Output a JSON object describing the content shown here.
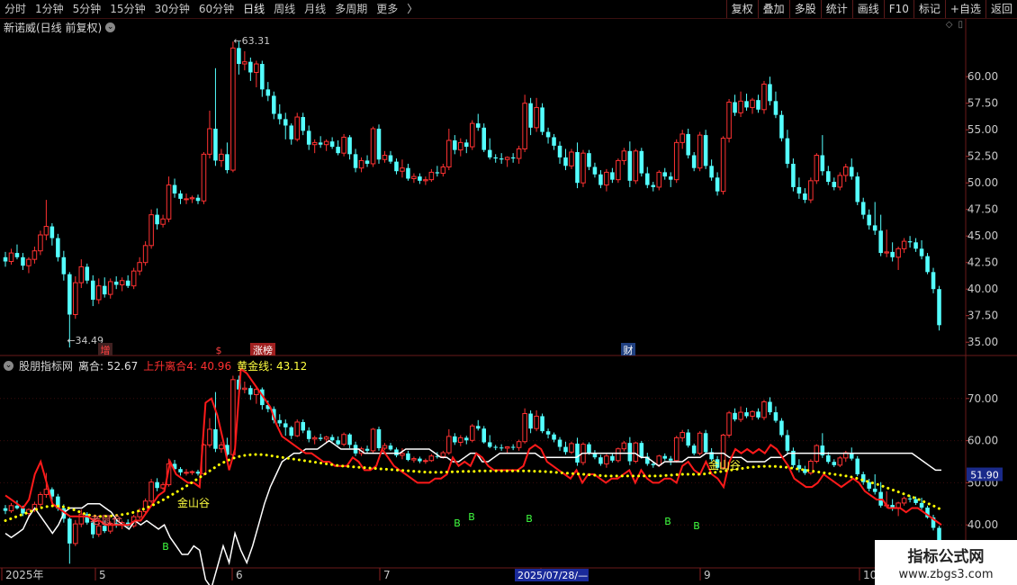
{
  "toolbar": {
    "periods": [
      "分时",
      "1分钟",
      "5分钟",
      "15分钟",
      "30分钟",
      "60分钟",
      "日线",
      "周线",
      "月线",
      "多周期",
      "更多"
    ],
    "active_period": "日线",
    "more_arrow": "〉",
    "right_buttons": [
      "复权",
      "叠加",
      "多股",
      "统计",
      "画线",
      "F10",
      "标记",
      "+自选",
      "返回"
    ]
  },
  "main_chart": {
    "title": "新诺威(日线 前复权)",
    "expand_icon": "chevron-down-icon",
    "high_label": "63.31",
    "low_label": "34.49",
    "y_ticks": [
      "60.00",
      "57.50",
      "55.00",
      "52.50",
      "50.00",
      "47.50",
      "45.00",
      "42.50",
      "40.00",
      "37.50",
      "35.00"
    ],
    "markers": [
      {
        "text": "增",
        "color": "#ff4040",
        "bg": "#402020"
      },
      {
        "text": "$",
        "color": "#ff4040",
        "bg": ""
      },
      {
        "text": "涨榜",
        "color": "#ffffff",
        "bg": "#a02020"
      },
      {
        "text": "财",
        "color": "#ffffff",
        "bg": "#204080"
      }
    ]
  },
  "indicator": {
    "name": "股朋指标网",
    "lihe_label": "离合: 52.67",
    "rise_label": "上升离合4: 40.96",
    "gold_label": "黄金线: 43.12",
    "y_ticks": [
      "70.00",
      "60.00",
      "50.00",
      "40.00"
    ],
    "current_value": "51.90",
    "labels": {
      "rat": "老鼠仓",
      "golden_valley_1": "金山谷",
      "golden_valley_2": "金山谷"
    },
    "buy_signal": "B"
  },
  "x_axis": {
    "labels": [
      "2025年",
      "5",
      "6",
      "7",
      "8",
      "9",
      "10"
    ],
    "cursor_date": "2025/07/28/—"
  },
  "watermark": {
    "line1": "指标公式网",
    "line2": "www.zbgs3.com"
  },
  "colors": {
    "up": "#ff3232",
    "down": "#54ffff",
    "background": "#000000",
    "grid": "#5a1a1a",
    "gold": "#ffff00"
  },
  "chart_data": {
    "type": "candlestick",
    "price_range": [
      34.0,
      64.0
    ],
    "candles": [
      [
        43.0,
        43.5,
        42.1,
        42.6
      ],
      [
        42.6,
        43.8,
        42.3,
        43.4
      ],
      [
        43.4,
        44.2,
        42.8,
        43.0
      ],
      [
        43.0,
        43.4,
        41.8,
        42.2
      ],
      [
        42.2,
        43.0,
        41.5,
        42.8
      ],
      [
        42.8,
        44.0,
        42.4,
        43.6
      ],
      [
        43.6,
        45.5,
        43.2,
        45.1
      ],
      [
        45.1,
        48.4,
        44.6,
        45.9
      ],
      [
        45.9,
        46.2,
        44.1,
        44.8
      ],
      [
        44.8,
        45.2,
        42.6,
        43.0
      ],
      [
        43.0,
        43.6,
        40.8,
        41.4
      ],
      [
        41.4,
        41.6,
        34.5,
        37.6
      ],
      [
        37.6,
        41.2,
        37.2,
        40.6
      ],
      [
        40.6,
        42.8,
        40.1,
        42.1
      ],
      [
        42.1,
        42.4,
        40.5,
        40.8
      ],
      [
        40.8,
        41.3,
        38.4,
        39.0
      ],
      [
        39.0,
        41.0,
        38.6,
        40.3
      ],
      [
        40.3,
        41.1,
        39.2,
        39.5
      ],
      [
        39.5,
        41.0,
        39.1,
        40.7
      ],
      [
        40.7,
        41.2,
        40.0,
        40.4
      ],
      [
        40.4,
        41.1,
        39.8,
        40.8
      ],
      [
        40.8,
        41.3,
        40.1,
        40.3
      ],
      [
        40.3,
        42.0,
        40.0,
        41.7
      ],
      [
        41.7,
        43.0,
        41.3,
        42.5
      ],
      [
        42.5,
        44.5,
        42.2,
        44.1
      ],
      [
        44.1,
        47.5,
        43.8,
        47.0
      ],
      [
        47.0,
        47.6,
        45.6,
        46.1
      ],
      [
        46.1,
        47.0,
        45.8,
        46.6
      ],
      [
        46.6,
        50.6,
        46.3,
        49.8
      ],
      [
        49.8,
        50.4,
        48.6,
        49.0
      ],
      [
        49.0,
        49.3,
        48.0,
        48.5
      ],
      [
        48.5,
        49.0,
        48.0,
        48.5
      ],
      [
        48.5,
        48.8,
        48.1,
        48.6
      ],
      [
        48.6,
        48.9,
        48.0,
        48.3
      ],
      [
        48.3,
        52.9,
        48.0,
        52.7
      ],
      [
        52.7,
        56.8,
        52.3,
        55.1
      ],
      [
        55.1,
        60.8,
        51.6,
        52.1
      ],
      [
        52.1,
        53.2,
        51.5,
        52.7
      ],
      [
        52.7,
        53.8,
        50.9,
        51.2
      ],
      [
        51.2,
        63.3,
        51.0,
        62.7
      ],
      [
        62.7,
        63.31,
        60.2,
        61.2
      ],
      [
        61.2,
        62.4,
        60.6,
        61.4
      ],
      [
        61.4,
        61.8,
        59.6,
        60.4
      ],
      [
        60.4,
        61.5,
        59.0,
        61.2
      ],
      [
        61.2,
        61.5,
        58.1,
        58.8
      ],
      [
        58.8,
        59.5,
        57.7,
        58.2
      ],
      [
        58.2,
        58.6,
        56.0,
        56.5
      ],
      [
        56.5,
        57.4,
        55.5,
        56.0
      ],
      [
        56.0,
        56.6,
        54.1,
        55.4
      ],
      [
        55.4,
        55.6,
        53.6,
        54.1
      ],
      [
        54.1,
        56.6,
        53.9,
        56.2
      ],
      [
        56.2,
        56.6,
        54.5,
        54.9
      ],
      [
        54.9,
        55.4,
        53.1,
        53.6
      ],
      [
        53.6,
        54.1,
        52.8,
        53.8
      ],
      [
        53.8,
        54.4,
        53.3,
        53.6
      ],
      [
        53.6,
        54.1,
        53.0,
        53.9
      ],
      [
        53.9,
        54.3,
        53.2,
        53.4
      ],
      [
        53.4,
        54.0,
        52.6,
        52.8
      ],
      [
        52.8,
        54.6,
        52.5,
        54.3
      ],
      [
        54.3,
        54.5,
        52.2,
        52.7
      ],
      [
        52.7,
        53.2,
        51.0,
        51.4
      ],
      [
        51.4,
        52.4,
        51.0,
        52.1
      ],
      [
        52.1,
        52.6,
        51.5,
        51.8
      ],
      [
        51.8,
        55.3,
        51.5,
        55.1
      ],
      [
        55.1,
        55.5,
        51.8,
        52.2
      ],
      [
        52.2,
        53.0,
        51.9,
        52.6
      ],
      [
        52.6,
        53.0,
        51.8,
        52.0
      ],
      [
        52.0,
        52.3,
        50.8,
        51.1
      ],
      [
        51.1,
        52.2,
        50.5,
        51.4
      ],
      [
        51.4,
        51.8,
        50.2,
        50.4
      ],
      [
        50.4,
        50.9,
        50.0,
        50.6
      ],
      [
        50.6,
        50.9,
        49.9,
        50.2
      ],
      [
        50.2,
        50.6,
        49.8,
        50.3
      ],
      [
        50.3,
        51.3,
        50.1,
        51.0
      ],
      [
        51.0,
        51.6,
        50.6,
        50.9
      ],
      [
        50.9,
        51.8,
        50.6,
        51.5
      ],
      [
        51.5,
        55.1,
        51.2,
        54.0
      ],
      [
        54.0,
        54.5,
        52.7,
        53.1
      ],
      [
        53.1,
        54.2,
        52.5,
        53.8
      ],
      [
        53.8,
        54.1,
        52.8,
        53.4
      ],
      [
        53.4,
        55.9,
        53.1,
        55.6
      ],
      [
        55.6,
        56.5,
        54.9,
        55.2
      ],
      [
        55.2,
        55.6,
        52.9,
        53.1
      ],
      [
        53.1,
        54.2,
        52.2,
        52.4
      ],
      [
        52.4,
        52.7,
        51.9,
        52.3
      ],
      [
        52.3,
        52.8,
        51.8,
        52.2
      ],
      [
        52.2,
        52.5,
        51.5,
        52.4
      ],
      [
        52.4,
        52.8,
        51.9,
        52.3
      ],
      [
        52.3,
        53.5,
        51.8,
        53.2
      ],
      [
        53.2,
        58.3,
        52.9,
        57.5
      ],
      [
        57.5,
        58.0,
        54.5,
        55.2
      ],
      [
        55.2,
        58.0,
        54.8,
        57.1
      ],
      [
        57.1,
        57.5,
        54.5,
        54.8
      ],
      [
        54.8,
        55.2,
        53.7,
        54.3
      ],
      [
        54.3,
        54.6,
        53.1,
        53.5
      ],
      [
        53.5,
        53.9,
        51.8,
        52.4
      ],
      [
        52.4,
        53.2,
        51.2,
        51.6
      ],
      [
        51.6,
        53.2,
        51.3,
        52.9
      ],
      [
        52.9,
        53.8,
        49.5,
        50.0
      ],
      [
        50.0,
        53.1,
        49.6,
        52.8
      ],
      [
        52.8,
        53.1,
        51.2,
        51.5
      ],
      [
        51.5,
        51.9,
        50.5,
        50.8
      ],
      [
        50.8,
        51.2,
        49.5,
        49.8
      ],
      [
        49.8,
        51.3,
        49.2,
        51.0
      ],
      [
        51.0,
        51.4,
        50.0,
        50.3
      ],
      [
        50.3,
        52.3,
        50.0,
        52.1
      ],
      [
        52.1,
        53.3,
        51.7,
        53.0
      ],
      [
        53.0,
        53.9,
        49.6,
        50.2
      ],
      [
        50.2,
        53.2,
        49.9,
        53.0
      ],
      [
        53.0,
        53.3,
        50.6,
        50.9
      ],
      [
        50.9,
        51.5,
        49.5,
        49.8
      ],
      [
        49.8,
        50.1,
        49.2,
        49.6
      ],
      [
        49.6,
        51.2,
        49.3,
        51.0
      ],
      [
        51.0,
        51.4,
        50.3,
        50.6
      ],
      [
        50.6,
        51.0,
        49.6,
        50.3
      ],
      [
        50.3,
        54.1,
        50.0,
        53.8
      ],
      [
        53.8,
        55.0,
        53.2,
        54.6
      ],
      [
        54.6,
        55.1,
        52.3,
        52.6
      ],
      [
        52.6,
        52.9,
        51.1,
        51.4
      ],
      [
        51.4,
        54.8,
        51.1,
        54.5
      ],
      [
        54.5,
        55.0,
        51.3,
        51.6
      ],
      [
        51.6,
        52.2,
        50.2,
        50.5
      ],
      [
        50.5,
        51.0,
        48.8,
        49.2
      ],
      [
        49.2,
        54.4,
        48.9,
        54.2
      ],
      [
        54.2,
        57.9,
        53.8,
        57.6
      ],
      [
        57.6,
        58.3,
        56.3,
        56.6
      ],
      [
        56.6,
        58.6,
        56.2,
        57.7
      ],
      [
        57.7,
        58.4,
        56.8,
        57.1
      ],
      [
        57.1,
        58.0,
        56.5,
        57.8
      ],
      [
        57.8,
        58.3,
        56.6,
        56.9
      ],
      [
        56.9,
        59.6,
        56.5,
        59.3
      ],
      [
        59.3,
        60.0,
        57.3,
        57.7
      ],
      [
        57.7,
        58.6,
        56.1,
        56.4
      ],
      [
        56.4,
        56.8,
        53.9,
        54.2
      ],
      [
        54.2,
        55.0,
        51.4,
        51.8
      ],
      [
        51.8,
        52.3,
        49.2,
        49.6
      ],
      [
        49.6,
        50.5,
        48.5,
        49.0
      ],
      [
        49.0,
        49.5,
        48.1,
        48.4
      ],
      [
        48.4,
        50.5,
        48.1,
        50.2
      ],
      [
        50.2,
        52.8,
        49.9,
        52.6
      ],
      [
        52.6,
        54.5,
        50.7,
        51.1
      ],
      [
        51.1,
        51.6,
        49.8,
        50.1
      ],
      [
        50.1,
        50.5,
        49.3,
        49.6
      ],
      [
        49.6,
        51.0,
        49.3,
        50.7
      ],
      [
        50.7,
        51.8,
        50.1,
        51.5
      ],
      [
        51.5,
        52.3,
        50.3,
        50.6
      ],
      [
        50.6,
        51.0,
        47.9,
        48.2
      ],
      [
        48.2,
        48.6,
        46.6,
        47.0
      ],
      [
        47.0,
        47.5,
        45.6,
        46.0
      ],
      [
        46.0,
        48.2,
        45.1,
        45.5
      ],
      [
        45.5,
        47.0,
        43.1,
        43.4
      ],
      [
        43.4,
        45.6,
        43.0,
        43.5
      ],
      [
        43.5,
        44.4,
        42.6,
        43.0
      ],
      [
        43.0,
        44.0,
        41.8,
        43.8
      ],
      [
        43.8,
        44.8,
        43.4,
        44.5
      ],
      [
        44.5,
        45.0,
        43.9,
        44.4
      ],
      [
        44.4,
        44.8,
        43.5,
        43.8
      ],
      [
        43.8,
        44.6,
        42.8,
        43.1
      ],
      [
        43.1,
        43.4,
        41.4,
        41.6
      ],
      [
        41.6,
        42.0,
        39.6,
        40.0
      ],
      [
        40.0,
        40.3,
        36.1,
        36.6
      ]
    ],
    "indicator_series": {
      "lihe_white": [
        38,
        37,
        38,
        39,
        42,
        44,
        42,
        40,
        38,
        40,
        43,
        44,
        44,
        44,
        45,
        45,
        45,
        44,
        43,
        41,
        40,
        39,
        41,
        40,
        41,
        40,
        39,
        40,
        37,
        35,
        33,
        33,
        35,
        34,
        27,
        25,
        30,
        35,
        31,
        38,
        34,
        31,
        35,
        40,
        45,
        49,
        52,
        55,
        56,
        57,
        57,
        58,
        58,
        58,
        59,
        60,
        59,
        58,
        58,
        58,
        58,
        57,
        57,
        57,
        57,
        57,
        57,
        57,
        58,
        58,
        58,
        58,
        58,
        57,
        56,
        56,
        55,
        55,
        56,
        57,
        57,
        55,
        55,
        56,
        57,
        57,
        57,
        57,
        57,
        57,
        57,
        56,
        56,
        56,
        56,
        56,
        56,
        56,
        57,
        57,
        57,
        57,
        57,
        57,
        57,
        57,
        57,
        57,
        56,
        56,
        55,
        54,
        55,
        55,
        55,
        55,
        56,
        56,
        56,
        57,
        57,
        57,
        57,
        56,
        56,
        56,
        55,
        55,
        55,
        55,
        56,
        56,
        56,
        57,
        57,
        57,
        57,
        57,
        57,
        57,
        57,
        57,
        57,
        57,
        57,
        57,
        57,
        57,
        57,
        57,
        57,
        57,
        57,
        57,
        57,
        56,
        55,
        54,
        53,
        53
      ],
      "rise_red": [
        47,
        46,
        45,
        44,
        46,
        52,
        55,
        50,
        45,
        44,
        43,
        42,
        42,
        42,
        42,
        41,
        41,
        40,
        40,
        40,
        40,
        40,
        41,
        41,
        43,
        45,
        47,
        48,
        55,
        52,
        51,
        50,
        50,
        49,
        69,
        70,
        66,
        60,
        53,
        58,
        77,
        76,
        74,
        72,
        70,
        68,
        64,
        61,
        60,
        59,
        58,
        57,
        57,
        56,
        55,
        55,
        54,
        54,
        54,
        56,
        55,
        53,
        53,
        54,
        58,
        56,
        54,
        53,
        52,
        51,
        50,
        50,
        50,
        51,
        51,
        52,
        56,
        54,
        55,
        54,
        57,
        56,
        54,
        53,
        53,
        53,
        53,
        53,
        54,
        58,
        59,
        58,
        55,
        54,
        53,
        52,
        51,
        53,
        50,
        52,
        52,
        51,
        50,
        51,
        51,
        52,
        53,
        50,
        53,
        51,
        50,
        50,
        51,
        51,
        50,
        54,
        55,
        53,
        52,
        55,
        52,
        51,
        49,
        55,
        58,
        57,
        58,
        57,
        58,
        57,
        59,
        58,
        56,
        54,
        51,
        50,
        49,
        49,
        50,
        52,
        51,
        50,
        49,
        50,
        51,
        50,
        48,
        47,
        46,
        46,
        44,
        44,
        44,
        43,
        44,
        44,
        43,
        42,
        41,
        40
      ],
      "gold_dotted": [
        41,
        41.5,
        42,
        42.5,
        43,
        43.5,
        44,
        44.3,
        44.5,
        44.5,
        44.3,
        44,
        43.5,
        43,
        42.5,
        42.2,
        42,
        42,
        42.1,
        42.2,
        42.4,
        42.6,
        42.9,
        43.3,
        43.8,
        44.4,
        45.0,
        45.7,
        46.5,
        47.3,
        48.1,
        48.9,
        49.8,
        50.7,
        51.6,
        52.5,
        53.4,
        54.3,
        55.0,
        55.6,
        56.1,
        56.4,
        56.6,
        56.7,
        56.7,
        56.6,
        56.4,
        56.2,
        56.0,
        55.8,
        55.6,
        55.4,
        55.2,
        55.0,
        54.8,
        54.6,
        54.4,
        54.2,
        54.0,
        53.9,
        53.8,
        53.7,
        53.6,
        53.5,
        53.4,
        53.3,
        53.2,
        53.1,
        53.0,
        52.9,
        52.8,
        52.7,
        52.6,
        52.5,
        52.5,
        52.5,
        52.5,
        52.6,
        52.6,
        52.7,
        52.7,
        52.7,
        52.8,
        52.8,
        52.8,
        52.8,
        52.8,
        52.8,
        52.8,
        52.8,
        52.8,
        52.8,
        52.7,
        52.7,
        52.6,
        52.5,
        52.4,
        52.3,
        52.2,
        52.1,
        52.0,
        51.9,
        51.8,
        51.7,
        51.6,
        51.6,
        51.6,
        51.6,
        51.6,
        51.6,
        51.6,
        51.6,
        51.6,
        51.6,
        51.7,
        51.8,
        51.9,
        52.0,
        52.0,
        52.0,
        52.0,
        52.1,
        52.3,
        52.5,
        52.7,
        52.9,
        53.1,
        53.3,
        53.5,
        53.7,
        53.8,
        53.9,
        53.9,
        53.9,
        53.8,
        53.7,
        53.5,
        53.3,
        53.1,
        52.9,
        52.7,
        52.5,
        52.3,
        52.1,
        51.9,
        51.7,
        51.5,
        51.2,
        50.8,
        50.4,
        50.0,
        49.6,
        49.1,
        48.6,
        48.1,
        47.6,
        47.1,
        46.6,
        46.1,
        45.5,
        44.9,
        44.3,
        43.6
      ]
    },
    "buy_signal_bars": [
      23,
      63,
      67,
      76,
      96,
      100
    ],
    "indicator_range": [
      30,
      80
    ]
  }
}
